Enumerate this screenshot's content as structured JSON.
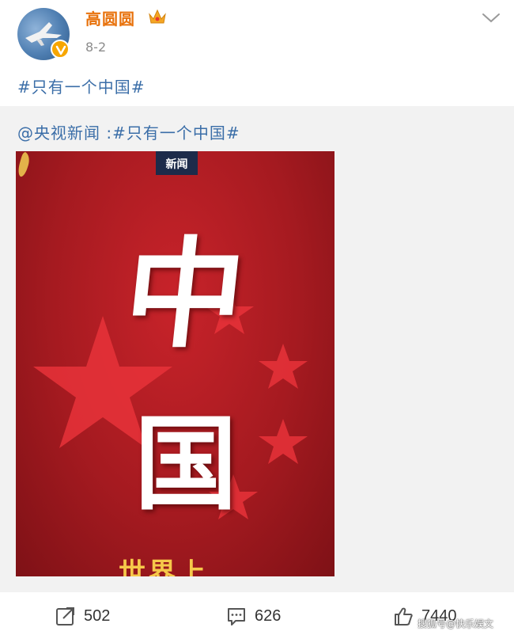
{
  "header": {
    "username": "高圆圆",
    "date": "8-2",
    "badge_icon": "verified-v-icon",
    "vip_icon": "crown-icon",
    "more_icon": "chevron-down-icon",
    "username_color": "#e8720c"
  },
  "post": {
    "text": "#只有一个中国#",
    "link_color": "#3b6ea8"
  },
  "repost": {
    "text": "@央视新闻 :#只有一个中国#",
    "image": {
      "logo_text": "新闻",
      "char_1": "中",
      "char_2": "国",
      "subtitle": "世界上",
      "colors": {
        "background": "#a51a20",
        "stars": "#e8333a",
        "subtitle": "#f6c84a"
      }
    }
  },
  "actions": {
    "repost_count": "502",
    "comment_count": "626",
    "like_count": "7440"
  },
  "watermark": "搜狐号@快乐娱文"
}
